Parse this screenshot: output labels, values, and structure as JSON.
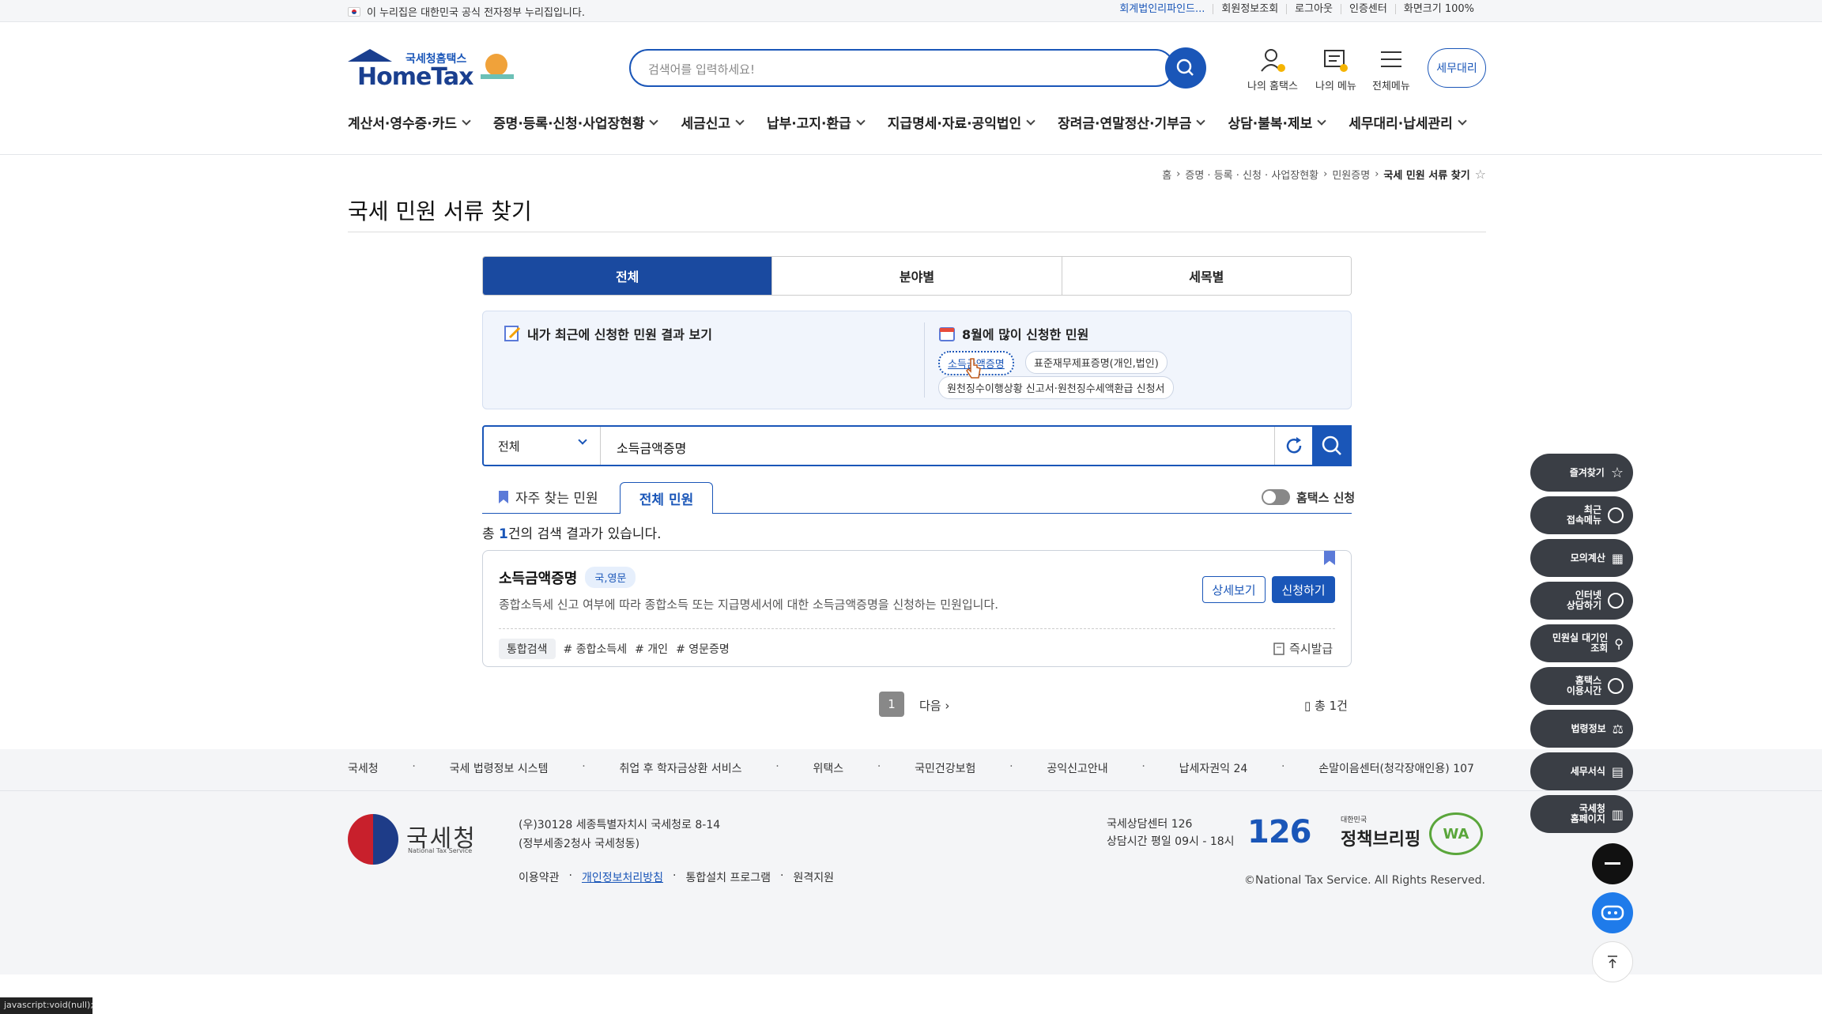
{
  "topbar": {
    "notice": "이 누리집은 대한민국 공식 전자정부 누리집입니다.",
    "links": [
      "회계법인리파인드...",
      "회원정보조회",
      "로그아웃",
      "인증센터",
      "화면크기 100%"
    ]
  },
  "header": {
    "logo_small": "국세청홈택스",
    "logo_main": "HomeTax",
    "search_placeholder": "검색어를 입력하세요!",
    "icons": [
      "나의 홈택스",
      "나의 메뉴",
      "전체메뉴"
    ],
    "tax_agent": "세무대리"
  },
  "gnb": [
    "계산서·영수증·카드",
    "증명·등록·신청·사업장현황",
    "세금신고",
    "납부·고지·환급",
    "지급명세·자료·공익법인",
    "장려금·연말정산·기부금",
    "상담·불복·제보",
    "세무대리·납세관리"
  ],
  "breadcrumb": [
    "홈",
    "증명 · 등록 · 신청 · 사업장현황",
    "민원증명",
    "국세 민원 서류 찾기"
  ],
  "page_title": "국세 민원 서류 찾기",
  "tabs": [
    "전체",
    "분야별",
    "세목별"
  ],
  "info": {
    "left_title": "내가 최근에 신청한 민원 결과 보기",
    "right_title": "8월에 많이 신청한 민원",
    "popular": [
      "소득금액증명",
      "표준재무제표증명(개인,법인)",
      "원천징수이행상황 신고서·원천징수세액환급 신청서"
    ]
  },
  "search": {
    "category": "전체",
    "value": "소득금액증명"
  },
  "subtabs": [
    "자주 찾는 민원",
    "전체 민원"
  ],
  "toggle_label": "홈택스 신청",
  "result_count": {
    "prefix": "총 ",
    "num": "1",
    "suffix": "건의 검색 결과가 있습니다."
  },
  "result": {
    "title": "소득금액증명",
    "lang": "국,영문",
    "desc": "종합소득세 신고 여부에 따라 종합소득 또는 지급명세서에 대한 소득금액증명을 신청하는 민원입니다.",
    "detail_btn": "상세보기",
    "apply_btn": "신청하기",
    "tags": [
      "통합검색",
      "# 종합소득세",
      "# 개인",
      "# 영문증명"
    ],
    "instant": "즉시발급"
  },
  "pagination": {
    "current": "1",
    "next": "다음",
    "total": "총 1건"
  },
  "footer": {
    "links": [
      "국세청",
      "국세 법령정보 시스템",
      "취업 후 학자금상환 서비스",
      "위택스",
      "국민건강보험",
      "공익신고안내",
      "납세자권익 24",
      "손말이음센터(청각장애인용) 107"
    ],
    "org": "국세청",
    "org_eng": "National Tax Service",
    "address1": "(우)30128 세종특별자치시 국세청로 8-14",
    "address2": "(정부세종2청사 국세청동)",
    "bottom_links": [
      "이용약관",
      "개인정보처리방침",
      "통합설치 프로그램",
      "원격지원"
    ],
    "call1": "국세상담센터 126",
    "call2": "상담시간 평일 09시 - 18시",
    "badge_126": "126",
    "jc_small": "대한민국",
    "jc": "정책브리핑",
    "wa": "WA",
    "copyright": "©National Tax Service. All Rights Reserved."
  },
  "quick": [
    "즐겨찾기",
    "최근\n접속메뉴",
    "모의계산",
    "인터넷\n상담하기",
    "민원실 대기인\n조회",
    "홈택스\n이용시간",
    "법령정보",
    "세무서식",
    "국세청\n홈페이지"
  ],
  "status_url": "javascript:void(null);",
  "colors": {
    "primary": "#1a56b8",
    "navy": "#1a4aa0",
    "dark": "#3a3e45"
  }
}
